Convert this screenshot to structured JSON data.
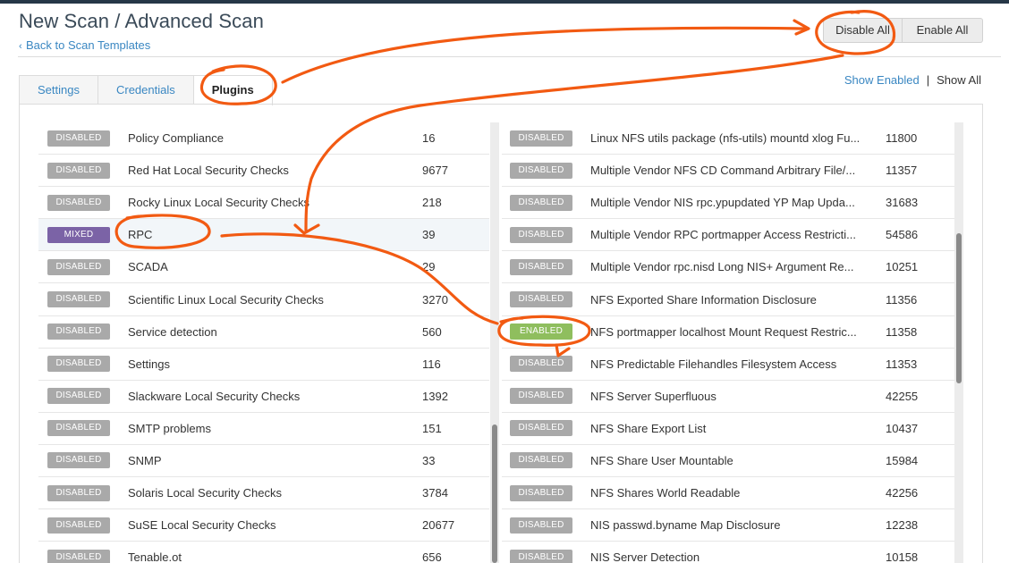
{
  "header": {
    "title": "New Scan / Advanced Scan",
    "back_link": "Back to Scan Templates"
  },
  "actions": {
    "disable_all": "Disable All",
    "enable_all": "Enable All"
  },
  "tabs": [
    {
      "label": "Settings"
    },
    {
      "label": "Credentials"
    },
    {
      "label": "Plugins"
    }
  ],
  "filter": {
    "show_enabled": "Show Enabled",
    "separator": "|",
    "show_all": "Show All"
  },
  "families": [
    {
      "status": "DISABLED",
      "name": "Policy Compliance",
      "count": "16"
    },
    {
      "status": "DISABLED",
      "name": "Red Hat Local Security Checks",
      "count": "9677"
    },
    {
      "status": "DISABLED",
      "name": "Rocky Linux Local Security Checks",
      "count": "218"
    },
    {
      "status": "MIXED",
      "name": "RPC",
      "count": "39"
    },
    {
      "status": "DISABLED",
      "name": "SCADA",
      "count": "29"
    },
    {
      "status": "DISABLED",
      "name": "Scientific Linux Local Security Checks",
      "count": "3270"
    },
    {
      "status": "DISABLED",
      "name": "Service detection",
      "count": "560"
    },
    {
      "status": "DISABLED",
      "name": "Settings",
      "count": "116"
    },
    {
      "status": "DISABLED",
      "name": "Slackware Local Security Checks",
      "count": "1392"
    },
    {
      "status": "DISABLED",
      "name": "SMTP problems",
      "count": "151"
    },
    {
      "status": "DISABLED",
      "name": "SNMP",
      "count": "33"
    },
    {
      "status": "DISABLED",
      "name": "Solaris Local Security Checks",
      "count": "3784"
    },
    {
      "status": "DISABLED",
      "name": "SuSE Local Security Checks",
      "count": "20677"
    },
    {
      "status": "DISABLED",
      "name": "Tenable.ot",
      "count": "656"
    }
  ],
  "plugins": [
    {
      "status": "DISABLED",
      "name": "Linux NFS utils package (nfs-utils) mountd xlog Fu...",
      "id": "11800"
    },
    {
      "status": "DISABLED",
      "name": "Multiple Vendor NFS CD Command Arbitrary File/...",
      "id": "11357"
    },
    {
      "status": "DISABLED",
      "name": "Multiple Vendor NIS rpc.ypupdated YP Map Upda...",
      "id": "31683"
    },
    {
      "status": "DISABLED",
      "name": "Multiple Vendor RPC portmapper Access Restricti...",
      "id": "54586"
    },
    {
      "status": "DISABLED",
      "name": "Multiple Vendor rpc.nisd Long NIS+ Argument Re...",
      "id": "10251"
    },
    {
      "status": "DISABLED",
      "name": "NFS Exported Share Information Disclosure",
      "id": "11356"
    },
    {
      "status": "ENABLED",
      "name": "NFS portmapper localhost Mount Request Restric...",
      "id": "11358"
    },
    {
      "status": "DISABLED",
      "name": "NFS Predictable Filehandles Filesystem Access",
      "id": "11353"
    },
    {
      "status": "DISABLED",
      "name": "NFS Server Superfluous",
      "id": "42255"
    },
    {
      "status": "DISABLED",
      "name": "NFS Share Export List",
      "id": "10437"
    },
    {
      "status": "DISABLED",
      "name": "NFS Share User Mountable",
      "id": "15984"
    },
    {
      "status": "DISABLED",
      "name": "NFS Shares World Readable",
      "id": "42256"
    },
    {
      "status": "DISABLED",
      "name": "NIS passwd.byname Map Disclosure",
      "id": "12238"
    },
    {
      "status": "DISABLED",
      "name": "NIS Server Detection",
      "id": "10158"
    }
  ],
  "colors": {
    "link": "#3a87c2",
    "disabled_badge": "#a9a9a9",
    "mixed_badge": "#7b63a6",
    "enabled_badge": "#8fbe5e",
    "annotation": "#f25a12"
  }
}
